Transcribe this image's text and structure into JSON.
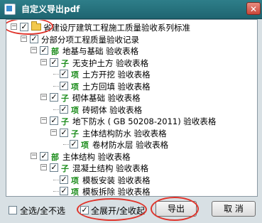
{
  "window": {
    "title": "自定义导出pdf",
    "close_glyph": "✕"
  },
  "tree": {
    "check_glyph": "✓",
    "expand_minus": "−",
    "items": [
      {
        "label": "省建设厅建筑工程施工质量验收系列标准",
        "prefix": ""
      },
      {
        "label": "分部分项工程质量验收记录",
        "prefix": ""
      },
      {
        "label": "地基与基础 验收表格",
        "prefix": "部"
      },
      {
        "label": "无支护土方 验收表格",
        "prefix": "子"
      },
      {
        "label": "土方开挖 验收表格",
        "prefix": "项"
      },
      {
        "label": "土方回填 验收表格",
        "prefix": "项"
      },
      {
        "label": "砌体基础 验收表格",
        "prefix": "子"
      },
      {
        "label": "砖砌体 验收表格",
        "prefix": "项"
      },
      {
        "label": "地下防水 ( GB 50208-2011) 验收表格",
        "prefix": "子"
      },
      {
        "label": "主体结构防水 验收表格",
        "prefix": "子"
      },
      {
        "label": "卷材防水层 验收表格",
        "prefix": "项"
      },
      {
        "label": "主体结构 验收表格",
        "prefix": "部"
      },
      {
        "label": "混凝土结构 验收表格",
        "prefix": "子"
      },
      {
        "label": "模板安装 验收表格",
        "prefix": "项"
      },
      {
        "label": "模板拆除 验收表格",
        "prefix": "项"
      }
    ]
  },
  "footer": {
    "select_all_label": "全选/全不选",
    "expand_all_label": "全展开/全收起",
    "export_button": "导出",
    "cancel_button": "取 消"
  }
}
